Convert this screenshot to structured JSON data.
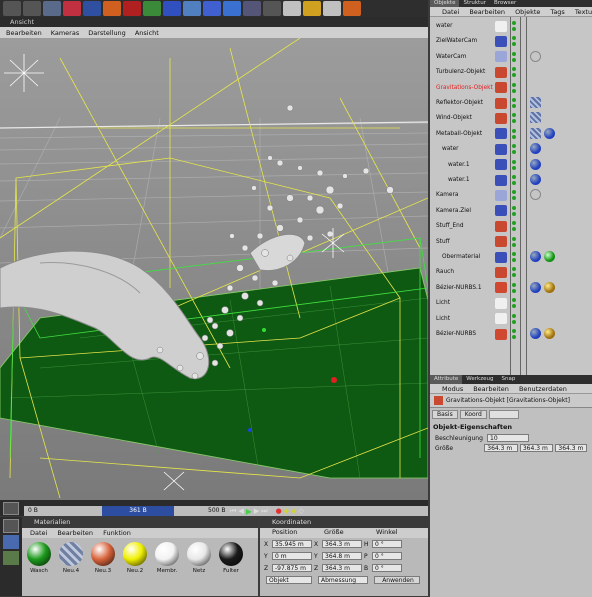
{
  "toolbar": {
    "icons": [
      "undo-icon",
      "redo-icon",
      "pointer-icon",
      "move-icon",
      "scale-icon",
      "rotate-icon",
      "x-axis-icon",
      "y-axis-icon",
      "z-axis-icon",
      "world-icon",
      "cube-icon",
      "nurbs-icon",
      "render-icon",
      "scene-icon",
      "light-icon",
      "gear-icon",
      "sphere-icon",
      "deformer-icon"
    ]
  },
  "viewport": {
    "title": "Ansicht",
    "menu": [
      "Bearbeiten",
      "Kameras",
      "Darstellung",
      "Ansicht"
    ]
  },
  "timeline": {
    "start": "0 B",
    "current": "361 B",
    "end": "500 B"
  },
  "materials": {
    "title": "Materialien",
    "menu": [
      "Datei",
      "Bearbeiten",
      "Funktion"
    ],
    "items": [
      {
        "label": "Wasch",
        "color": "#1c9a1c"
      },
      {
        "label": "Neu.4",
        "color": "#8fa0c0"
      },
      {
        "label": "Neu.3",
        "color": "#d8643c"
      },
      {
        "label": "Neu.2",
        "color": "#f0f000"
      },
      {
        "label": "Membr.",
        "color": "#f2f2f2"
      },
      {
        "label": "Netz",
        "color": "#e8e8e8"
      },
      {
        "label": "Fulter",
        "color": "#1a1a1a"
      }
    ]
  },
  "coords": {
    "title": "Koordinaten",
    "headers": [
      "Position",
      "Größe",
      "Winkel"
    ],
    "rows": [
      {
        "pa": "X",
        "pv": "35.945 m",
        "sa": "X",
        "sv": "364.3 m",
        "ra": "H",
        "rv": "0 °"
      },
      {
        "pa": "Y",
        "pv": "0 m",
        "sa": "Y",
        "sv": "364.8 m",
        "ra": "P",
        "rv": "0 °"
      },
      {
        "pa": "Z",
        "pv": "-97.875 m",
        "sa": "Z",
        "sv": "364.3 m",
        "ra": "B",
        "rv": "0 °"
      }
    ],
    "mode": "Objekt",
    "size_mode": "Abmessung",
    "apply": "Anwenden"
  },
  "objects": {
    "tabs": [
      "Objekte",
      "Struktur",
      "Browser"
    ],
    "menu": [
      "Datei",
      "Bearbeiten",
      "Objekte",
      "Tags",
      "Textur"
    ],
    "items": [
      {
        "name": "water",
        "indent": 0,
        "icon": "#f0f0f0",
        "tags": []
      },
      {
        "name": "ZielWaterCam",
        "indent": 0,
        "icon": "#3a50b8",
        "tags": []
      },
      {
        "name": "WaterCam",
        "indent": 0,
        "icon": "#9aa6d8",
        "tags": [
          "target"
        ]
      },
      {
        "name": "Turbulenz-Objekt",
        "indent": 0,
        "icon": "#c84830",
        "tags": []
      },
      {
        "name": "Gravitations-Objekt",
        "indent": 0,
        "icon": "#c84830",
        "tags": [],
        "selected": true
      },
      {
        "name": "Reflektor-Objekt",
        "indent": 0,
        "icon": "#c84830",
        "tags": [
          "tex"
        ]
      },
      {
        "name": "Wind-Objekt",
        "indent": 0,
        "icon": "#c84830",
        "tags": [
          "tex"
        ]
      },
      {
        "name": "Metaball-Objekt",
        "indent": 0,
        "icon": "#3a50b8",
        "tags": [
          "tex",
          "blue"
        ]
      },
      {
        "name": "water",
        "indent": 1,
        "icon": "#3a50b8",
        "tags": [
          "blue"
        ]
      },
      {
        "name": "water.1",
        "indent": 2,
        "icon": "#3a50b8",
        "tags": [
          "blue"
        ]
      },
      {
        "name": "water.1",
        "indent": 2,
        "icon": "#3a50b8",
        "tags": [
          "blue"
        ]
      },
      {
        "name": "Kamera",
        "indent": 0,
        "icon": "#9aa6d8",
        "tags": [
          "target"
        ]
      },
      {
        "name": "Kamera.Ziel",
        "indent": 0,
        "icon": "#3a50b8",
        "tags": []
      },
      {
        "name": "Stuff_End",
        "indent": 0,
        "icon": "#c84830",
        "tags": []
      },
      {
        "name": "Stuff",
        "indent": 0,
        "icon": "#c84830",
        "tags": []
      },
      {
        "name": "Obermaterial",
        "indent": 1,
        "icon": "#3a50b8",
        "tags": [
          "blue",
          "green"
        ]
      },
      {
        "name": "Rauch",
        "indent": 0,
        "icon": "#c84830",
        "tags": []
      },
      {
        "name": "Bézier-NURBS.1",
        "indent": 0,
        "icon": "#d04830",
        "tags": [
          "blue",
          "gold"
        ]
      },
      {
        "name": "Licht",
        "indent": 0,
        "icon": "#f0f0f0",
        "tags": []
      },
      {
        "name": "Licht",
        "indent": 0,
        "icon": "#f0f0f0",
        "tags": []
      },
      {
        "name": "Bézier-NURBS",
        "indent": 0,
        "icon": "#d04830",
        "tags": [
          "blue",
          "gold"
        ]
      }
    ]
  },
  "attributes": {
    "tabs": [
      "Attribute",
      "Werkzeug",
      "Snap"
    ],
    "menu": [
      "Modus",
      "Bearbeiten",
      "Benutzerdaten"
    ],
    "object_title": "Gravitations-Objekt [Gravitations-Objekt]",
    "buttons": [
      "Basis",
      "Koord",
      "Objekt"
    ],
    "section": "Objekt-Eigenschaften",
    "accel_label": "Beschleunigung",
    "accel_value": "10",
    "size_label": "Größe",
    "size_values": [
      "364.3 m",
      "364.3 m",
      "364.3 m"
    ]
  }
}
